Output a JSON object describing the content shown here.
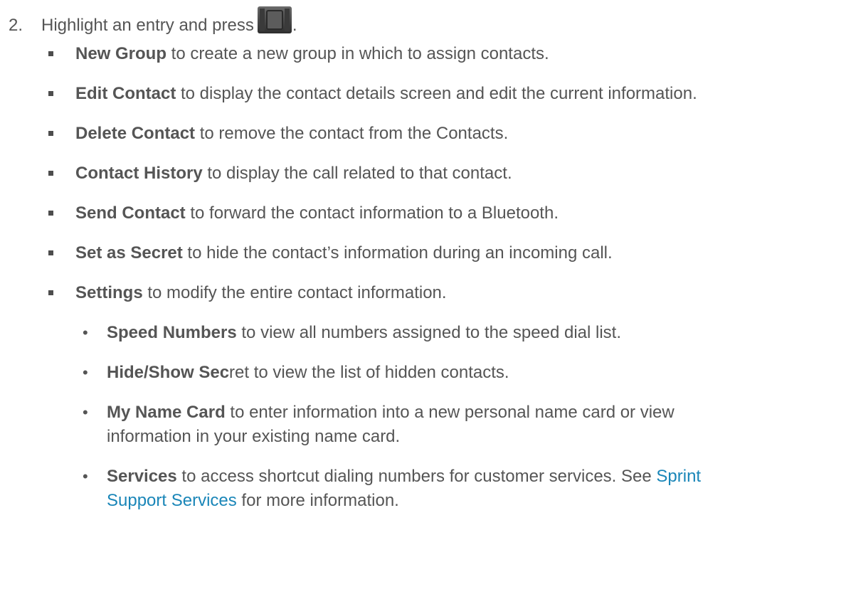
{
  "step": {
    "number": "2.",
    "text": "Highlight an entry and press",
    "after_icon": ".",
    "icon": "menu-key-icon"
  },
  "options": [
    {
      "label": "New Group",
      "desc": " to create a new group in which to assign contacts."
    },
    {
      "label": "Edit Contact",
      "desc": " to display the contact details screen and edit the current information."
    },
    {
      "label": "Delete Contact",
      "desc": " to remove the contact from the Contacts."
    },
    {
      "label": "Contact History",
      "desc": " to display the call related to that contact."
    },
    {
      "label": "Send Contact",
      "desc": " to forward the contact information to a Bluetooth."
    },
    {
      "label": "Set as Secret",
      "desc": " to hide the contact’s information during an incoming call."
    },
    {
      "label": "Settings",
      "desc": " to modify the entire contact information."
    }
  ],
  "settings_options": [
    {
      "label": "Speed Numbers",
      "desc": " to view all numbers assigned to the speed dial list."
    },
    {
      "label": "Hide/Show Sec",
      "desc": "ret to view the list of hidden contacts."
    },
    {
      "label": "My Name Card",
      "desc": " to enter information into a new personal name card or view",
      "desc2": "information in your existing name card."
    },
    {
      "label": "Services",
      "desc": " to access shortcut dialing numbers for customer services. See ",
      "link1": "Sprint",
      "link2": "Support Services",
      "desc2": " for more information."
    }
  ],
  "bullet_glyph": "•",
  "colors": {
    "text": "#555555",
    "link": "#1a86b8"
  }
}
